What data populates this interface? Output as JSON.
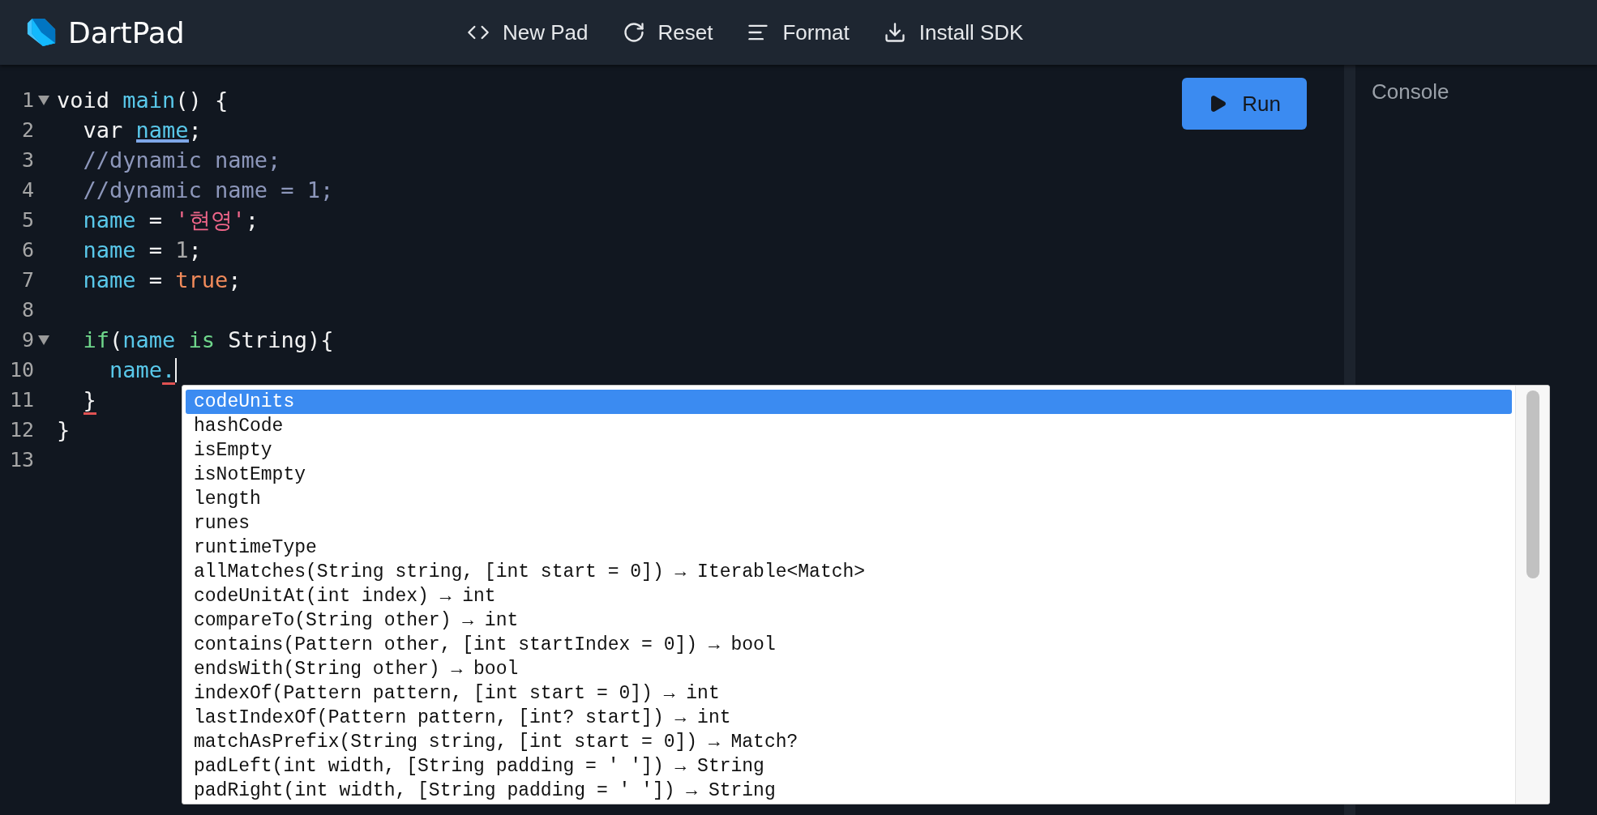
{
  "header": {
    "title": "DartPad",
    "actions": [
      {
        "label": "New Pad",
        "kind": "code"
      },
      {
        "label": "Reset",
        "kind": "reset"
      },
      {
        "label": "Format",
        "kind": "format"
      },
      {
        "label": "Install SDK",
        "kind": "download"
      }
    ]
  },
  "editor": {
    "run_button": "Run",
    "lines": [
      {
        "number": "1",
        "foldable": true,
        "cursor": false,
        "tokens": [
          {
            "text": "void ",
            "kind": "plain",
            "highlight": false,
            "error": false
          },
          {
            "text": "main",
            "kind": "identifier",
            "highlight": false,
            "error": false
          },
          {
            "text": "() {",
            "kind": "plain",
            "highlight": false,
            "error": false
          }
        ]
      },
      {
        "number": "2",
        "foldable": false,
        "cursor": false,
        "tokens": [
          {
            "text": "  var ",
            "kind": "plain",
            "highlight": false,
            "error": false
          },
          {
            "text": "name",
            "kind": "identifier",
            "highlight": true,
            "error": false
          },
          {
            "text": ";",
            "kind": "plain",
            "highlight": false,
            "error": false
          }
        ]
      },
      {
        "number": "3",
        "foldable": false,
        "cursor": false,
        "tokens": [
          {
            "text": "  //dynamic name;",
            "kind": "comment",
            "highlight": false,
            "error": false
          }
        ]
      },
      {
        "number": "4",
        "foldable": false,
        "cursor": false,
        "tokens": [
          {
            "text": "  //dynamic name = 1;",
            "kind": "comment",
            "highlight": false,
            "error": false
          }
        ]
      },
      {
        "number": "5",
        "foldable": false,
        "cursor": false,
        "tokens": [
          {
            "text": "  name",
            "kind": "identifier",
            "highlight": false,
            "error": false
          },
          {
            "text": " = ",
            "kind": "plain",
            "highlight": false,
            "error": false
          },
          {
            "text": "'현영'",
            "kind": "string",
            "highlight": false,
            "error": false
          },
          {
            "text": ";",
            "kind": "plain",
            "highlight": false,
            "error": false
          }
        ]
      },
      {
        "number": "6",
        "foldable": false,
        "cursor": false,
        "tokens": [
          {
            "text": "  name",
            "kind": "identifier",
            "highlight": false,
            "error": false
          },
          {
            "text": " = ",
            "kind": "plain",
            "highlight": false,
            "error": false
          },
          {
            "text": "1",
            "kind": "number",
            "highlight": false,
            "error": false
          },
          {
            "text": ";",
            "kind": "plain",
            "highlight": false,
            "error": false
          }
        ]
      },
      {
        "number": "7",
        "foldable": false,
        "cursor": false,
        "tokens": [
          {
            "text": "  name",
            "kind": "identifier",
            "highlight": false,
            "error": false
          },
          {
            "text": " = ",
            "kind": "plain",
            "highlight": false,
            "error": false
          },
          {
            "text": "true",
            "kind": "literal",
            "highlight": false,
            "error": false
          },
          {
            "text": ";",
            "kind": "plain",
            "highlight": false,
            "error": false
          }
        ]
      },
      {
        "number": "8",
        "foldable": false,
        "cursor": false
      },
      {
        "number": "9",
        "foldable": true,
        "cursor": false,
        "tokens": [
          {
            "text": "  if",
            "kind": "keyword",
            "highlight": false,
            "error": false
          },
          {
            "text": "(",
            "kind": "plain",
            "highlight": false,
            "error": false
          },
          {
            "text": "name",
            "kind": "identifier",
            "highlight": false,
            "error": false
          },
          {
            "text": " is ",
            "kind": "keyword",
            "highlight": false,
            "error": false
          },
          {
            "text": "String){",
            "kind": "plain",
            "highlight": false,
            "error": false
          }
        ]
      },
      {
        "number": "10",
        "foldable": false,
        "cursor": true,
        "tokens": [
          {
            "text": "    name",
            "kind": "identifier",
            "highlight": false,
            "error": false
          },
          {
            "text": ".",
            "kind": "identifier",
            "highlight": false,
            "error": true
          }
        ]
      },
      {
        "number": "11",
        "foldable": false,
        "cursor": false,
        "tokens": [
          {
            "text": "  }",
            "kind": "plain",
            "highlight": false,
            "error": true
          }
        ]
      },
      {
        "number": "12",
        "foldable": false,
        "cursor": false,
        "tokens": [
          {
            "text": "}",
            "kind": "plain",
            "highlight": false,
            "error": false
          }
        ]
      },
      {
        "number": "13",
        "foldable": false,
        "cursor": false
      }
    ]
  },
  "completions": [
    {
      "label": "codeUnits",
      "selected": true
    },
    {
      "label": "hashCode",
      "selected": false
    },
    {
      "label": "isEmpty",
      "selected": false
    },
    {
      "label": "isNotEmpty",
      "selected": false
    },
    {
      "label": "length",
      "selected": false
    },
    {
      "label": "runes",
      "selected": false
    },
    {
      "label": "runtimeType",
      "selected": false
    },
    {
      "label": "allMatches(String string, [int start = 0]) → Iterable<Match>",
      "selected": false
    },
    {
      "label": "codeUnitAt(int index) → int",
      "selected": false
    },
    {
      "label": "compareTo(String other) → int",
      "selected": false
    },
    {
      "label": "contains(Pattern other, [int startIndex = 0]) → bool",
      "selected": false
    },
    {
      "label": "endsWith(String other) → bool",
      "selected": false
    },
    {
      "label": "indexOf(Pattern pattern, [int start = 0]) → int",
      "selected": false
    },
    {
      "label": "lastIndexOf(Pattern pattern, [int? start]) → int",
      "selected": false
    },
    {
      "label": "matchAsPrefix(String string, [int start = 0]) → Match?",
      "selected": false
    },
    {
      "label": "padLeft(int width, [String padding = ' ']) → String",
      "selected": false
    },
    {
      "label": "padRight(int width, [String padding = ' ']) → String",
      "selected": false
    }
  ],
  "console": {
    "title": "Console"
  }
}
